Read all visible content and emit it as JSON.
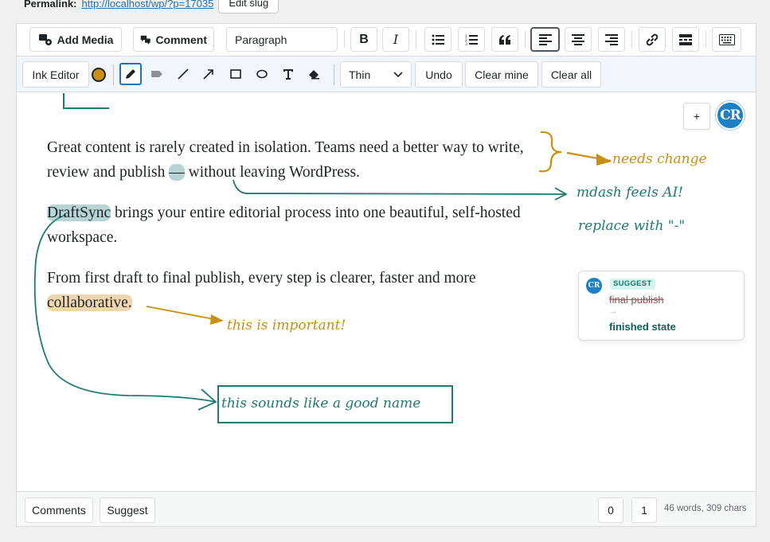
{
  "permalink": {
    "label": "Permalink:",
    "url": "http://localhost/wp/?p=17035",
    "edit_slug": "Edit slug"
  },
  "toolbar": {
    "add_media": "Add Media",
    "comment": "Comment",
    "block_format": "Paragraph",
    "bold": "B",
    "italic": "I"
  },
  "ink_toolbar": {
    "label": "Ink Editor",
    "active_color": "#c8900e",
    "stroke_width": "Thin",
    "undo": "Undo",
    "clear_mine": "Clear mine",
    "clear_all": "Clear all"
  },
  "content": {
    "p1_before": "Great content is rarely created in isolation. Teams need a better way to write, review and publish ",
    "p1_mark": "—",
    "p1_after": " without leaving WordPress.",
    "p2_mark": "DraftSync",
    "p2_after": " brings your entire editorial process into one beautiful, self-hosted workspace.",
    "p3_before": "From first draft to final publish, every step is clearer, faster and more ",
    "p3_mark": "collaborative.",
    "p3_after": ""
  },
  "annotations": {
    "needs_change": "needs change",
    "mdash": "mdash feels AI!",
    "replace": "replace with \"-\"",
    "important": "this is important!",
    "good_name": "this sounds like a good name"
  },
  "ink_colors": {
    "gold": "#c8900e",
    "teal": "#1f7a70"
  },
  "add_button": "+",
  "avatar_initials": "CR",
  "suggestion": {
    "badge": "SUGGEST",
    "old": "final publish",
    "arrow": "→",
    "new": "finished state"
  },
  "footer": {
    "comments": "Comments",
    "suggest": "Suggest",
    "counter_a": "0",
    "counter_b": "1",
    "stats": "46 words, 309 chars"
  }
}
